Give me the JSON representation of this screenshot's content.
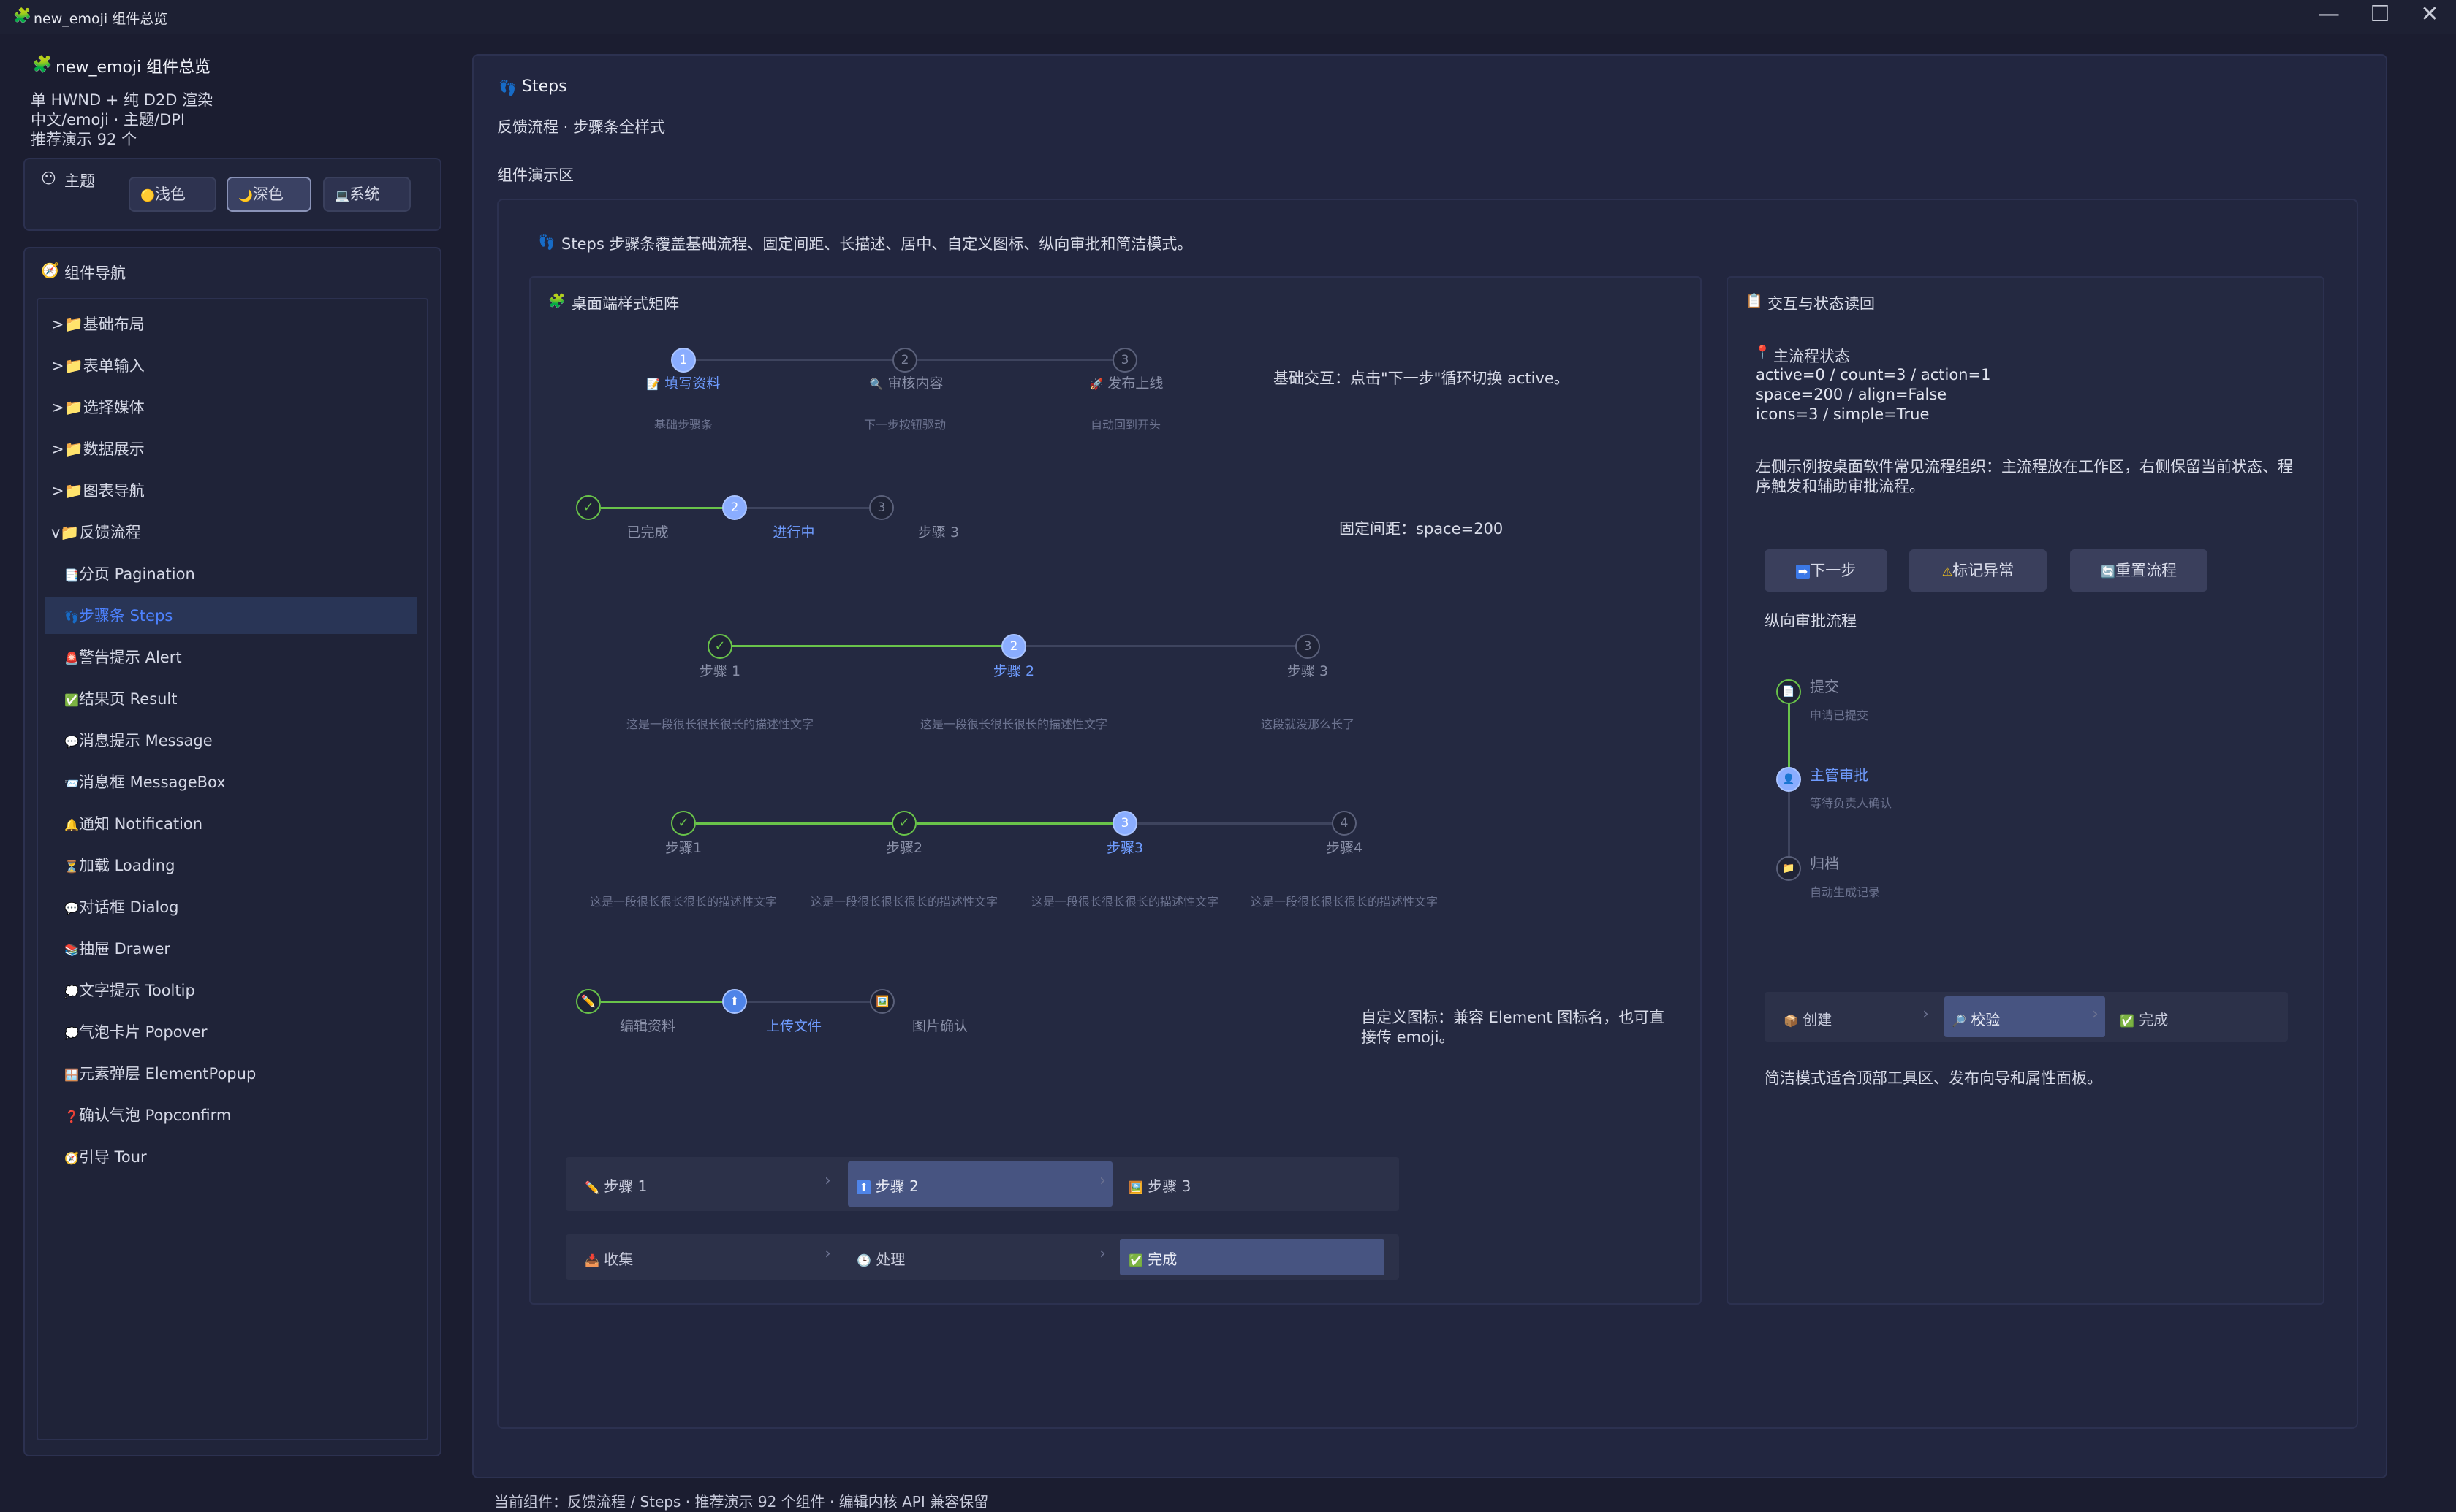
{
  "window": {
    "title": "new_emoji 组件总览",
    "controls": [
      "—",
      "☐",
      "✕"
    ]
  },
  "sidebar": {
    "app_title": "new_emoji 组件总览",
    "info": [
      "单 HWND + 纯 D2D 渲染",
      "中文/emoji · 主题/DPI",
      "推荐演示 92 个"
    ],
    "theme": {
      "label": "主题",
      "options": [
        {
          "icon": "🟡",
          "label": "浅色"
        },
        {
          "icon": "🌙",
          "label": "深色"
        },
        {
          "icon": "💻",
          "label": "系统"
        }
      ],
      "selected": "深色"
    },
    "nav_title": "组件导航",
    "groups": [
      ">📁基础布局",
      ">📁表单输入",
      ">📁选择媒体",
      ">📁数据展示",
      ">📁图表导航",
      "v📁反馈流程"
    ],
    "items": [
      "分页 Pagination",
      "步骤条 Steps",
      "警告提示 Alert",
      "结果页 Result",
      "消息提示 Message",
      "消息框 MessageBox",
      "通知 Notification",
      "加载 Loading",
      "对话框 Dialog",
      "抽屉 Drawer",
      "文字提示 Tooltip",
      "气泡卡片 Popover",
      "元素弹层 ElementPopup",
      "确认气泡 Popconfirm",
      "引导 Tour"
    ],
    "item_icons": [
      "📑",
      "👣",
      "🚨",
      "✅",
      "💬",
      "📨",
      "🔔",
      "⏳",
      "💬",
      "📚",
      "💭",
      "💭",
      "🪟",
      "❓",
      "🧭"
    ],
    "active_item": "步骤条 Steps"
  },
  "main": {
    "title": "Steps",
    "subtitle": "反馈流程 · 步骤条全样式",
    "demo_area_label": "组件演示区",
    "intro": "Steps 步骤条覆盖基础流程、固定间距、长描述、居中、自定义图标、纵向审批和简洁模式。",
    "matrix": {
      "title": "桌面端样式矩阵",
      "row1": {
        "steps": [
          {
            "num": "1",
            "icon": "📝",
            "title": "填写资料",
            "desc": "基础步骤条"
          },
          {
            "num": "2",
            "icon": "🔍",
            "title": "审核内容",
            "desc": "下一步按钮驱动"
          },
          {
            "num": "3",
            "icon": "🚀",
            "title": "发布上线",
            "desc": "自动回到开头"
          }
        ],
        "note": "基础交互：点击\"下一步\"循环切换 active。"
      },
      "row2": {
        "steps": [
          {
            "num": "✓",
            "title": "已完成"
          },
          {
            "num": "2",
            "title": "进行中"
          },
          {
            "num": "3",
            "title": "步骤 3"
          }
        ],
        "note": "固定间距：space=200"
      },
      "row3": {
        "steps": [
          {
            "num": "✓",
            "title": "步骤 1",
            "desc": "这是一段很长很长很长的描述性文字"
          },
          {
            "num": "2",
            "title": "步骤 2",
            "desc": "这是一段很长很长很长的描述性文字"
          },
          {
            "num": "3",
            "title": "步骤 3",
            "desc": "这段就没那么长了"
          }
        ]
      },
      "row4": {
        "steps": [
          {
            "num": "✓",
            "title": "步骤1",
            "desc": "这是一段很长很长很长的描述性文字"
          },
          {
            "num": "✓",
            "title": "步骤2",
            "desc": "这是一段很长很长很长的描述性文字"
          },
          {
            "num": "3",
            "title": "步骤3",
            "desc": "这是一段很长很长很长的描述性文字"
          },
          {
            "num": "4",
            "title": "步骤4",
            "desc": "这是一段很长很长很长的描述性文字"
          }
        ]
      },
      "row5": {
        "steps": [
          {
            "icon": "✏️",
            "title": "编辑资料"
          },
          {
            "icon": "⬆",
            "title": "上传文件"
          },
          {
            "icon": "🖼️",
            "title": "图片确认"
          }
        ],
        "note": "自定义图标：兼容 Element 图标名，也可直接传 emoji。"
      },
      "simple1": [
        {
          "icon": "✏️",
          "label": "步骤 1"
        },
        {
          "icon": "⬆",
          "label": "步骤 2"
        },
        {
          "icon": "🖼️",
          "label": "步骤 3"
        }
      ],
      "simple2": [
        {
          "icon": "📥",
          "label": "收集"
        },
        {
          "icon": "🕒",
          "label": "处理"
        },
        {
          "icon": "✅",
          "label": "完成"
        }
      ]
    },
    "status": {
      "title": "交互与状态读回",
      "state_title": "主流程状态",
      "state_lines": [
        "active=0 / count=3 / action=1",
        "space=200 / align=False",
        "icons=3 / simple=True"
      ],
      "description": "左侧示例按桌面软件常见流程组织：主流程放在工作区，右侧保留当前状态、程序触发和辅助审批流程。",
      "buttons": [
        {
          "icon": "➡",
          "label": "下一步"
        },
        {
          "icon": "⚠",
          "label": "标记异常"
        },
        {
          "icon": "🔄",
          "label": "重置流程"
        }
      ],
      "vertical_title": "纵向审批流程",
      "vertical_steps": [
        {
          "icon": "📄",
          "title": "提交",
          "desc": "申请已提交"
        },
        {
          "icon": "👤",
          "title": "主管审批",
          "desc": "等待负责人确认"
        },
        {
          "icon": "📁",
          "title": "归档",
          "desc": "自动生成记录"
        }
      ],
      "simple3": [
        {
          "icon": "📦",
          "label": "创建"
        },
        {
          "icon": "🔎",
          "label": "校验"
        },
        {
          "icon": "✅",
          "label": "完成"
        }
      ],
      "footer_note": "简洁模式适合顶部工具区、发布向导和属性面板。"
    }
  },
  "statusbar": "当前组件：反馈流程 / Steps · 推荐演示 92 个组件 · 编辑内核 API 兼容保留",
  "colors": {
    "accent": "#6f9cff",
    "done": "#69c34a",
    "background": "#1b1d30",
    "panel": "#20243a"
  }
}
